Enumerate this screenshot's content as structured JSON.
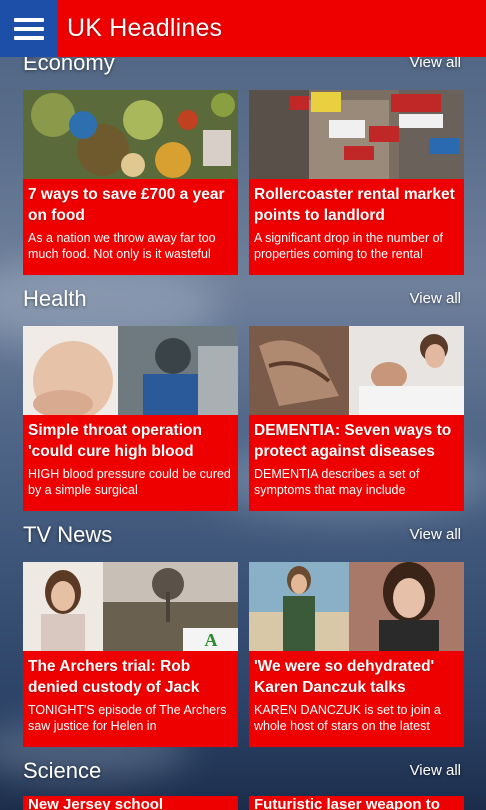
{
  "header": {
    "title": "UK Headlines"
  },
  "sections": [
    {
      "title": "Economy",
      "view_all": "View all",
      "cards": [
        {
          "headline": "7 ways to save £700 a year on food",
          "summary": "As a nation we throw away far too much food. Not only is it wasteful"
        },
        {
          "headline": "Rollercoaster rental market points to landlord",
          "summary": "A significant drop in the number of properties coming to the rental"
        }
      ]
    },
    {
      "title": "Health",
      "view_all": "View all",
      "cards": [
        {
          "headline": "Simple throat operation 'could cure high blood",
          "summary": "HIGH blood pressure could be cured by a simple surgical"
        },
        {
          "headline": "DEMENTIA: Seven ways to protect against diseases",
          "summary": "DEMENTIA describes a set of symptoms that may include"
        }
      ]
    },
    {
      "title": "TV News",
      "view_all": "View all",
      "cards": [
        {
          "headline": "The Archers trial: Rob denied custody of Jack",
          "summary": "TONIGHT'S episode of The Archers saw justice for Helen in"
        },
        {
          "headline": "'We were so dehydrated' Karen Danczuk talks",
          "summary": "KAREN DANCZUK is set to join a whole host of stars on the latest"
        }
      ]
    },
    {
      "title": "Science",
      "view_all": "View all",
      "cards": [
        {
          "headline": "New Jersey school",
          "summary": ""
        },
        {
          "headline": "Futuristic laser weapon to",
          "summary": ""
        }
      ]
    }
  ],
  "colors": {
    "brand_red": "#ee0000",
    "menu_blue": "#1d4fa8"
  },
  "icons": {
    "menu": "hamburger-menu-icon"
  }
}
